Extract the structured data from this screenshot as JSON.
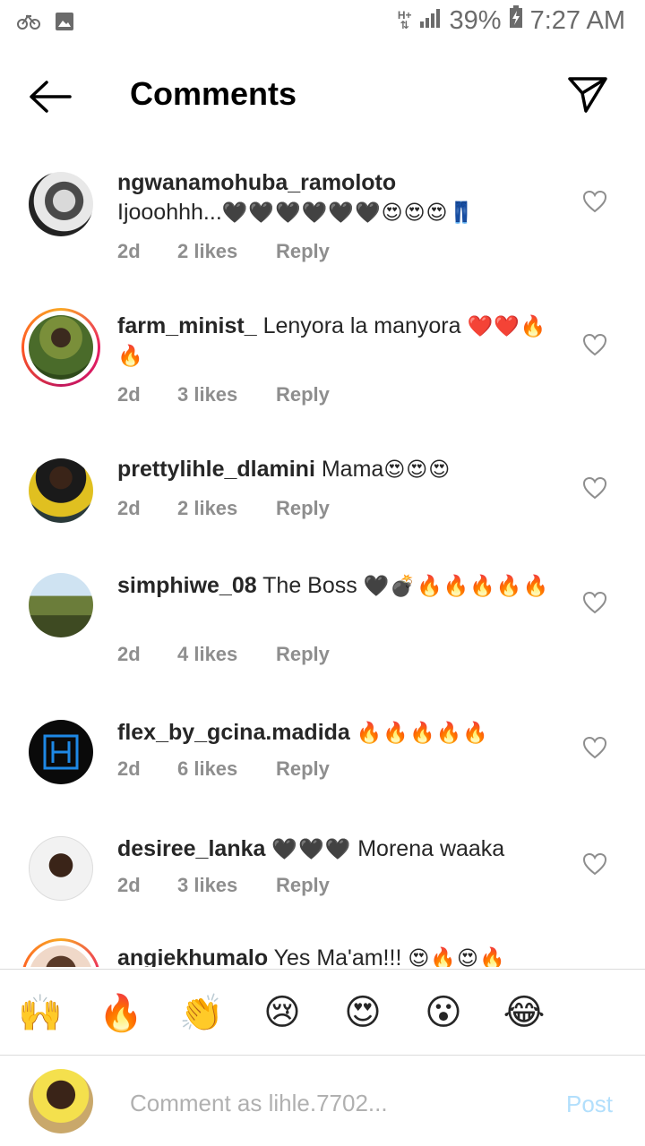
{
  "status_bar": {
    "signal_label": "H+",
    "battery": "39%",
    "time": "7:27 AM"
  },
  "header": {
    "title": "Comments"
  },
  "comments": [
    {
      "username": "ngwanamohuba_ramoloto",
      "text": "Ijooohhh...",
      "emoji": "🖤🖤🖤🖤🖤🖤😍😍😍👖",
      "time": "2d",
      "likes": "2 likes",
      "reply": "Reply"
    },
    {
      "username": "farm_minist_",
      "text": "Lenyora la manyora",
      "emoji": "❤️❤️🔥🔥",
      "time": "2d",
      "likes": "3 likes",
      "reply": "Reply"
    },
    {
      "username": "prettylihle_dlamini",
      "text": "Mama",
      "emoji": "😍😍😍",
      "time": "2d",
      "likes": "2 likes",
      "reply": "Reply"
    },
    {
      "username": "simphiwe_08",
      "text": "The Boss",
      "emoji": "🖤💣🔥🔥🔥🔥🔥",
      "time": "2d",
      "likes": "4 likes",
      "reply": "Reply"
    },
    {
      "username": "flex_by_gcina.madida",
      "text": "",
      "emoji": "🔥🔥🔥🔥🔥",
      "time": "2d",
      "likes": "6 likes",
      "reply": "Reply"
    },
    {
      "username": "desiree_lanka",
      "text": "Morena waaka",
      "emoji": "🖤🖤🖤",
      "time": "2d",
      "likes": "3 likes",
      "reply": "Reply"
    },
    {
      "username": "angiekhumalo",
      "text": "Yes Ma'am!!!",
      "emoji": "😍🔥😍🔥"
    }
  ],
  "reactions": [
    "🙌",
    "🔥",
    "👏",
    "😢",
    "😍",
    "😮",
    "😂"
  ],
  "composer": {
    "placeholder": "Comment as lihle.7702...",
    "post_label": "Post"
  },
  "colors": {
    "accent_post_disabled": "#b2dffc",
    "meta_gray": "#8e8e8e",
    "heart_red": "#e8344a",
    "fire": "#ff6d00"
  }
}
